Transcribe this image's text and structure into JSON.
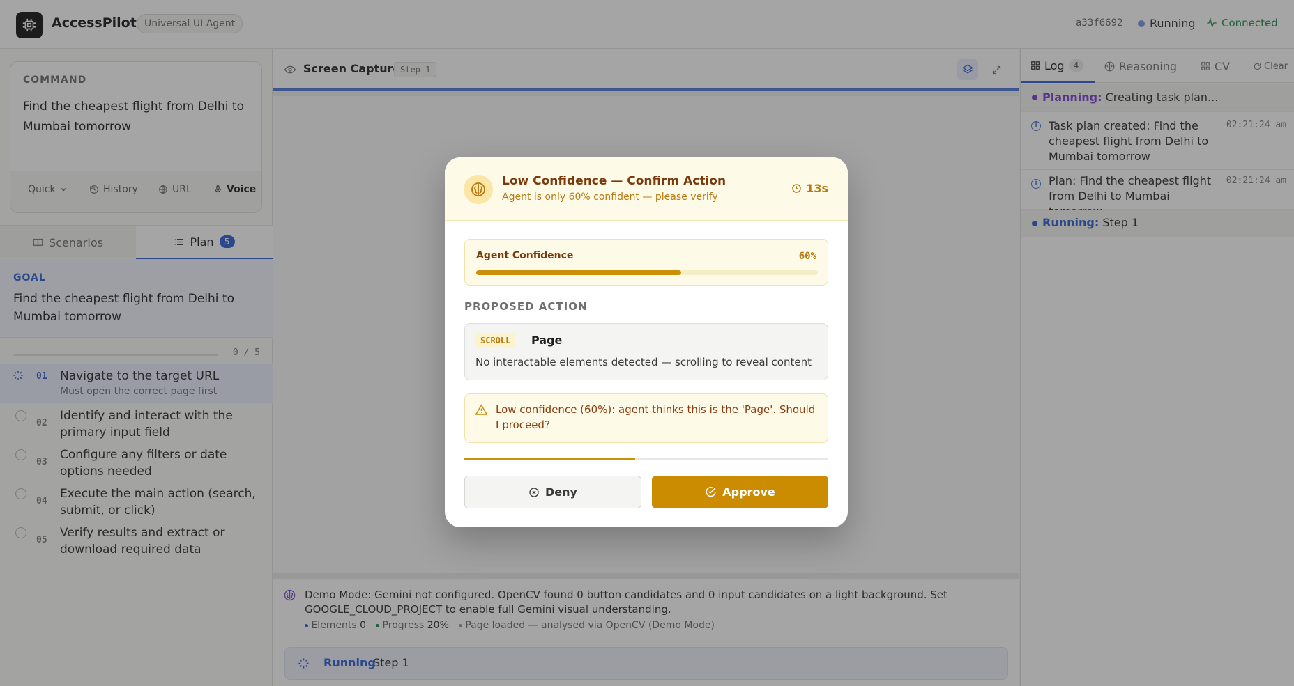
{
  "header": {
    "app_name": "AccessPilot",
    "badge": "Universal UI Agent",
    "session_id": "a33f6692",
    "status": "Running",
    "connection": "Connected"
  },
  "command": {
    "label": "COMMAND",
    "text": "Find the cheapest flight from Delhi to Mumbai tomorrow",
    "toolbar": {
      "mode": "Quick",
      "history": "History",
      "url": "URL",
      "voice": "Voice"
    }
  },
  "left_tabs": {
    "scenarios": "Scenarios",
    "plan": "Plan",
    "plan_count": "5"
  },
  "goal": {
    "label": "GOAL",
    "text": "Find the cheapest flight from Delhi to Mumbai tomorrow"
  },
  "plan": {
    "progress": "0 / 5",
    "progress_fraction": 0,
    "steps": [
      {
        "num": "01",
        "title": "Navigate to the target URL",
        "sub": "Must open the correct page first"
      },
      {
        "num": "02",
        "title": "Identify and interact with the primary input field",
        "sub": ""
      },
      {
        "num": "03",
        "title": "Configure any filters or date options needed",
        "sub": ""
      },
      {
        "num": "04",
        "title": "Execute the main action (search, submit, or click)",
        "sub": ""
      },
      {
        "num": "05",
        "title": "Verify results and extract or download required data",
        "sub": ""
      }
    ]
  },
  "screen": {
    "title": "Screen Capture",
    "step_tag": "Step 1",
    "demo_text": "Demo Mode: Gemini not configured. OpenCV found 0 button candidates and 0 input candidates on a light background. Set GOOGLE_CLOUD_PROJECT to enable full Gemini visual understanding.",
    "stats": {
      "elements_label": "Elements",
      "elements_value": "0",
      "progress_label": "Progress",
      "progress_value": "20%",
      "page_note": "Page loaded — analysed via OpenCV (Demo Mode)"
    },
    "running_label": "Running",
    "running_value": "Step 1"
  },
  "right_tabs": {
    "log": "Log",
    "log_count": "4",
    "reasoning": "Reasoning",
    "cv": "CV",
    "clear": "Clear"
  },
  "log": {
    "entries": [
      {
        "kind": "Planning:",
        "text": "Creating task plan..."
      },
      {
        "text": "Task plan created: Find the cheapest flight from Delhi to Mumbai tomorrow",
        "time": "02:21:24 am"
      },
      {
        "text": "Plan: Find the cheapest flight from Delhi to Mumbai tomorrow",
        "time": "02:21:24 am"
      },
      {
        "kind": "Running:",
        "text": "Step 1"
      }
    ]
  },
  "modal": {
    "title": "Low Confidence — Confirm Action",
    "subtitle": "Agent is only 60% confident — please verify",
    "timer": "13s",
    "confidence_label": "Agent Confidence",
    "confidence_value": "60%",
    "confidence_fraction": 0.6,
    "proposed_label": "PROPOSED ACTION",
    "action_type": "SCROLL",
    "action_target": "Page",
    "action_desc": "No interactable elements detected — scrolling to reveal content",
    "warning": "Low confidence (60%): agent thinks this is the 'Page'. Should I proceed?",
    "countdown_fraction": 0.47,
    "deny": "Deny",
    "approve": "Approve"
  },
  "colors": {
    "accent": "#2f5fd6",
    "warning": "#cc8c02",
    "success": "#1f8a4c"
  }
}
